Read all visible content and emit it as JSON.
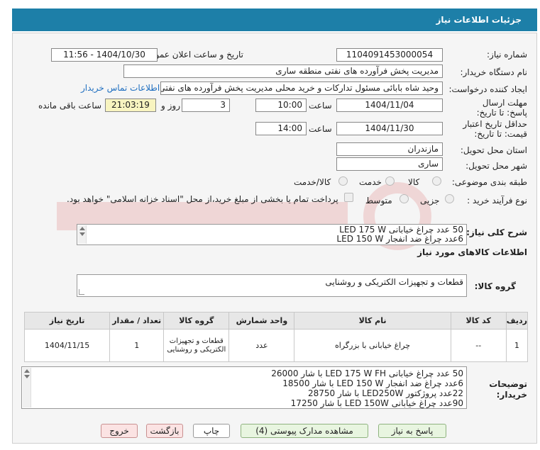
{
  "header": {
    "title": "جزئیات اطلاعات نیاز"
  },
  "fields": {
    "need_number_label": "شماره نیاز:",
    "need_number": "1104091453000054",
    "announce_label": "تاریخ و ساعت اعلان عمومی:",
    "announce_value": "1404/10/30 - 11:56",
    "buyer_org_label": "نام دستگاه خریدار:",
    "buyer_org": "مدیریت پخش فرآورده های نفتی منطقه ساری",
    "requester_label": "ایجاد کننده درخواست:",
    "requester": "وحید شاه بابائی مسئول تدارکات و خرید محلی مدیریت پخش فرآورده های نفتی",
    "contact_link": "اطلاعات تماس خریدار",
    "deadline_label": "مهلت ارسال پاسخ: تا تاریخ:",
    "deadline_date": "1404/11/04",
    "time_label": "ساعت",
    "deadline_time": "10:00",
    "days_value": "3",
    "days_label": "روز و",
    "remaining_time": "21:03:19",
    "remaining_label": "ساعت باقی مانده",
    "validity_label": "حداقل تاریخ اعتبار قیمت: تا تاریخ:",
    "validity_date": "1404/11/30",
    "validity_time_label": "ساعت",
    "validity_time": "14:00",
    "province_label": "استان محل تحویل:",
    "province": "مازندران",
    "city_label": "شهر محل تحویل:",
    "city": "ساری",
    "category_label": "طبقه بندی موضوعی:",
    "category_options": [
      "کالا",
      "خدمت",
      "کالا/خدمت"
    ],
    "process_label": "نوع فرآیند خرید :",
    "process_options": [
      "جزیی",
      "متوسط"
    ],
    "treasury_note": "پرداخت تمام یا بخشی از مبلغ خرید،از محل \"اسناد خزانه اسلامی\" خواهد بود."
  },
  "description": {
    "label": "شرح کلی نیاز:",
    "lines": [
      "50 عدد چراغ خیابانی LED 175 W",
      "6عدد چراغ ضد انفجار LED 150 W"
    ]
  },
  "goods_info_title": "اطلاعات کالاهای مورد نیاز",
  "goods_group": {
    "label": "گروه کالا:",
    "value": "قطعات و تجهیزات الکتریکی و روشنایی"
  },
  "table": {
    "headers": [
      "ردیف",
      "کد کالا",
      "نام کالا",
      "واحد شمارش",
      "گروه کالا",
      "تعداد / مقدار",
      "تاریخ نیاز"
    ],
    "rows": [
      [
        "1",
        "--",
        "چراغ خیابانی با بزرگراه",
        "عدد",
        "قطعات و تجهیزات الکتریکی و روشنایی",
        "1",
        "1404/11/15"
      ]
    ]
  },
  "buyer_notes": {
    "label": "توضیحات خریدار:",
    "lines": [
      "50 عدد چراغ خیابانی LED 175 W FH با شار 26000",
      "6عدد چراغ ضد انفجار LED 150 W با شار 18500",
      "22عدد پروژکتور LED250W با شار 28750",
      "90عدد چراغ خیابانی LED 150W با شار 17250"
    ]
  },
  "buttons": {
    "reply": "پاسخ به نیاز",
    "docs": "مشاهده مدارک پیوستی (4)",
    "print": "چاپ",
    "back": "بازگشت",
    "exit": "خروج"
  },
  "colors": {
    "header_bg": "#1d7fa8",
    "link": "#1f6fc0",
    "countdown_bg": "#f8f4c0"
  }
}
